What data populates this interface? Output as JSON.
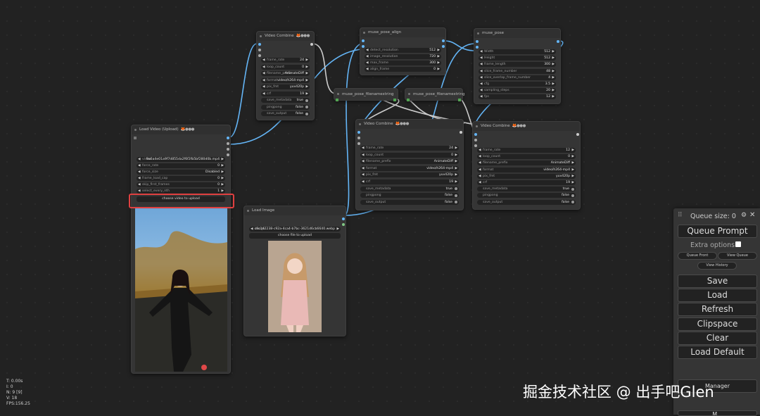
{
  "nodes": {
    "load_video": {
      "title": "Load Video (Upload)",
      "badges": "🦊●●●",
      "widgets": [
        {
          "label": "video",
          "value": "9a6a4e01a9f7d855da2f6f2fb5bf280d0b.mp4"
        },
        {
          "label": "force_rate",
          "value": "0"
        },
        {
          "label": "force_size",
          "value": "Disabled"
        },
        {
          "label": "frame_load_cap",
          "value": "0"
        },
        {
          "label": "skip_first_frames",
          "value": "0"
        },
        {
          "label": "select_every_nth",
          "value": "1"
        }
      ],
      "upload_button": "choose video to upload"
    },
    "load_image": {
      "title": "Load Image",
      "image_value": "c8c142238-c92a-4ca4-b7bc-3621d6cb6640.webp",
      "image_label": "image",
      "upload_button": "choose file to upload"
    },
    "video_combine_1": {
      "title": "Video Combine",
      "badges": "🦊●●●",
      "widgets": [
        {
          "label": "frame_rate",
          "value": "24"
        },
        {
          "label": "loop_count",
          "value": "0"
        },
        {
          "label": "filename_prefix",
          "value": "AnimateDiff"
        },
        {
          "label": "format",
          "value": "video/h264-mp4"
        },
        {
          "label": "pix_fmt",
          "value": "yuv420p"
        },
        {
          "label": "crf",
          "value": "19"
        },
        {
          "label": "save_metadata",
          "value": "true"
        },
        {
          "label": "pingpong",
          "value": "false"
        },
        {
          "label": "save_output",
          "value": "false"
        }
      ]
    },
    "muse_pose_align": {
      "title": "muse_pose_align",
      "widgets": [
        {
          "label": "detect_resolution",
          "value": "512"
        },
        {
          "label": "image_resolution",
          "value": "720"
        },
        {
          "label": "max_frame",
          "value": "300"
        },
        {
          "label": "align_frame",
          "value": "0"
        }
      ]
    },
    "muse_pose": {
      "title": "muse_pose",
      "widgets": [
        {
          "label": "Width",
          "value": "512"
        },
        {
          "label": "Height",
          "value": "512"
        },
        {
          "label": "frame_length",
          "value": "300"
        },
        {
          "label": "slice_frame_number",
          "value": "48"
        },
        {
          "label": "slice_overlap_frame_number",
          "value": "4"
        },
        {
          "label": "cfg",
          "value": "3.5"
        },
        {
          "label": "sampling_steps",
          "value": "20"
        },
        {
          "label": "fps",
          "value": "12"
        }
      ]
    },
    "filenamestring_1": {
      "title": "muse_pose_filenamestring"
    },
    "filenamestring_2": {
      "title": "muse_pose_filenamestring"
    },
    "video_combine_2": {
      "title": "Video Combine",
      "badges": "🦊●●●",
      "widgets": [
        {
          "label": "frame_rate",
          "value": "24"
        },
        {
          "label": "loop_count",
          "value": "0"
        },
        {
          "label": "filename_prefix",
          "value": "AnimateDiff"
        },
        {
          "label": "format",
          "value": "video/h264-mp4"
        },
        {
          "label": "pix_fmt",
          "value": "yuv420p"
        },
        {
          "label": "crf",
          "value": "19"
        },
        {
          "label": "save_metadata",
          "value": "true"
        },
        {
          "label": "pingpong",
          "value": "false"
        },
        {
          "label": "save_output",
          "value": "false"
        }
      ]
    },
    "video_combine_3": {
      "title": "Video Combine",
      "badges": "🦊●●●",
      "widgets": [
        {
          "label": "frame_rate",
          "value": "12"
        },
        {
          "label": "loop_count",
          "value": "0"
        },
        {
          "label": "filename_prefix",
          "value": "AnimateDiff"
        },
        {
          "label": "format",
          "value": "video/h264-mp4"
        },
        {
          "label": "pix_fmt",
          "value": "yuv420p"
        },
        {
          "label": "crf",
          "value": "19"
        },
        {
          "label": "save_metadata",
          "value": "true"
        },
        {
          "label": "pingpong",
          "value": "false"
        },
        {
          "label": "save_output",
          "value": "false"
        }
      ]
    }
  },
  "queue_panel": {
    "title": "Queue size: 0",
    "queue_prompt": "Queue Prompt",
    "extra_options": "Extra options",
    "queue_front": "Queue Front",
    "view_queue": "View Queue",
    "view_history": "View History",
    "save": "Save",
    "load": "Load",
    "refresh": "Refresh",
    "clipspace": "Clipspace",
    "clear": "Clear",
    "load_default": "Load Default",
    "manager": "Manager",
    "more": "M..."
  },
  "stats": {
    "t": "T: 0.00s",
    "i": "I: 0",
    "n": "N: 9 [9]",
    "v": "V: 18",
    "fps": "FPS:156.25"
  },
  "watermark": "掘金技术社区 @ 出手吧Glen",
  "colors": {
    "canvas": "#222222",
    "node": "#353535",
    "link_image": "#64b5f6",
    "link_string": "#cccccc",
    "highlight": "#e04040",
    "slot_green": "#52a552"
  }
}
